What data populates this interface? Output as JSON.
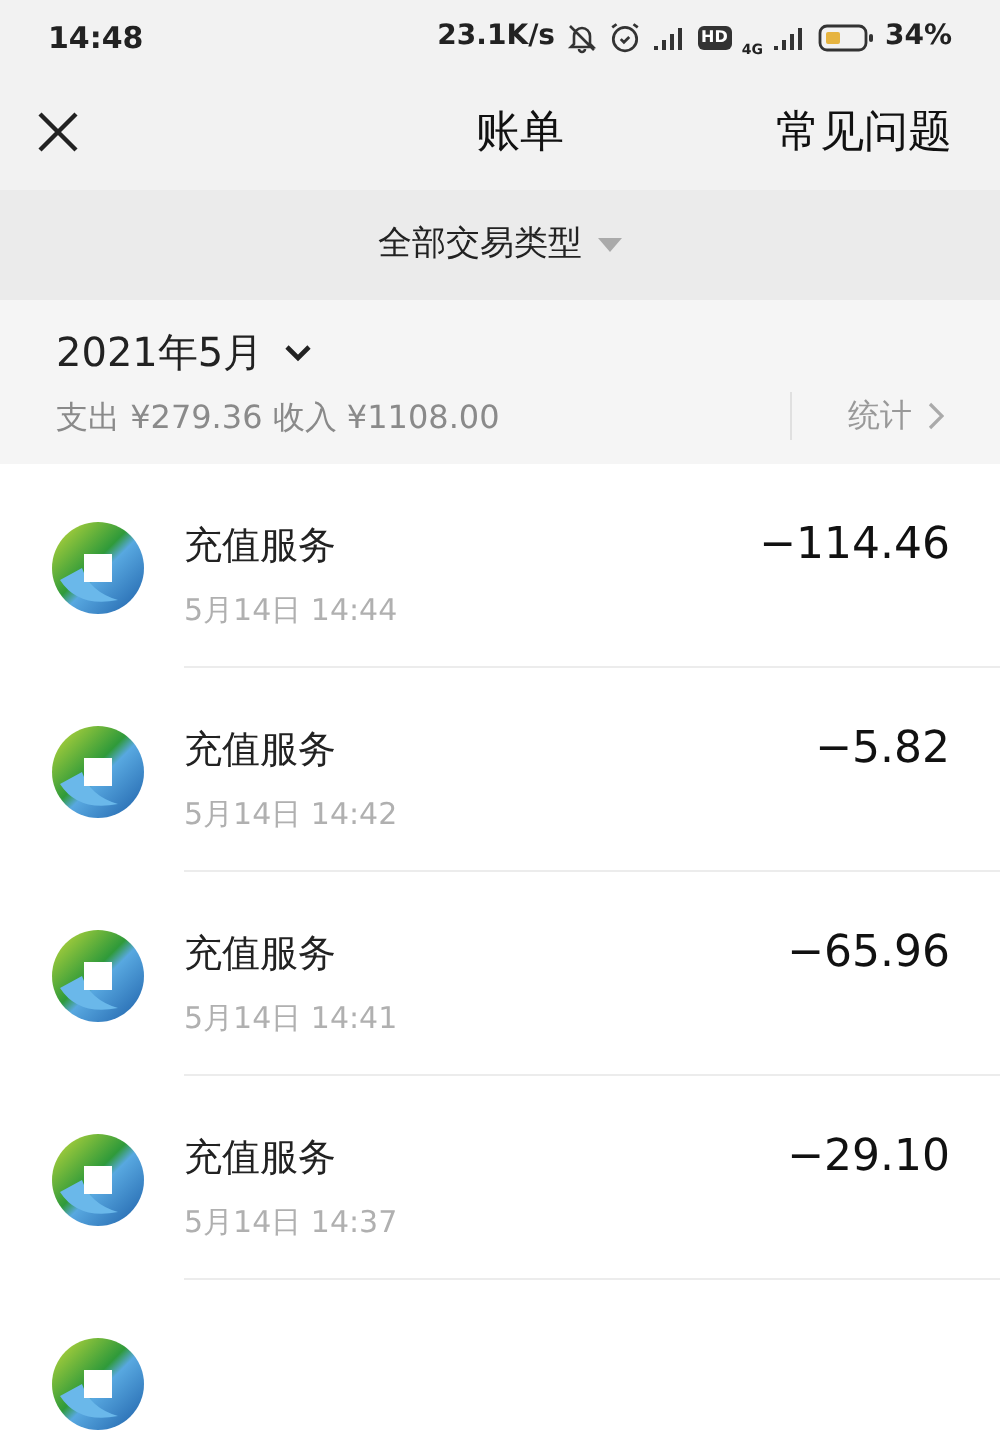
{
  "status_bar": {
    "time": "14:48",
    "speed": "23.1K/s",
    "hd": "HD",
    "network": "4G",
    "battery": "34%"
  },
  "header": {
    "title": "账单",
    "help": "常见问题"
  },
  "filter": {
    "label": "全部交易类型"
  },
  "month": {
    "label": "2021年5月",
    "summary": "支出 ¥279.36 收入 ¥1108.00",
    "stats": "统计"
  },
  "transactions": [
    {
      "title": "充值服务",
      "time": "5月14日 14:44",
      "amount": "−114.46"
    },
    {
      "title": "充值服务",
      "time": "5月14日 14:42",
      "amount": "−5.82"
    },
    {
      "title": "充值服务",
      "time": "5月14日 14:41",
      "amount": "−65.96"
    },
    {
      "title": "充值服务",
      "time": "5月14日 14:37",
      "amount": "−29.10"
    }
  ]
}
